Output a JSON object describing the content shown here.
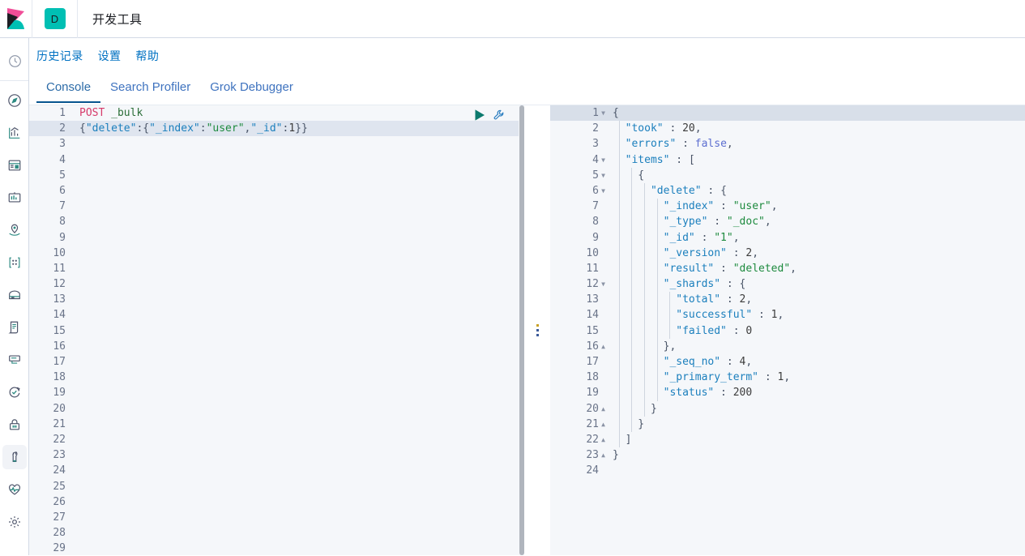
{
  "header": {
    "logo_icon": "kibana-logo",
    "app_badge": "D",
    "title": "开发工具"
  },
  "sidebar": {
    "items": [
      {
        "icon": "clock-icon",
        "name": "recently-viewed",
        "active": false
      },
      {
        "icon": "compass-icon",
        "name": "discover",
        "active": false
      },
      {
        "icon": "visualize-icon",
        "name": "visualize",
        "active": false
      },
      {
        "icon": "dashboard-icon",
        "name": "dashboard",
        "active": false
      },
      {
        "icon": "canvas-icon",
        "name": "canvas",
        "active": false
      },
      {
        "icon": "maps-icon",
        "name": "maps",
        "active": false
      },
      {
        "icon": "machine-learning-icon",
        "name": "machine-learning",
        "active": false
      },
      {
        "icon": "infrastructure-icon",
        "name": "infrastructure",
        "active": false
      },
      {
        "icon": "logs-icon",
        "name": "logs",
        "active": false
      },
      {
        "icon": "apm-icon",
        "name": "apm",
        "active": false
      },
      {
        "icon": "uptime-icon",
        "name": "uptime",
        "active": false
      },
      {
        "icon": "lock-icon",
        "name": "siem",
        "active": false
      },
      {
        "icon": "wrench-icon",
        "name": "dev-tools",
        "active": true
      },
      {
        "icon": "heartbeat-icon",
        "name": "monitoring",
        "active": false
      },
      {
        "icon": "gear-icon",
        "name": "management",
        "active": false
      }
    ]
  },
  "console": {
    "menu": [
      {
        "label": "历史记录",
        "name": "history-link"
      },
      {
        "label": "设置",
        "name": "settings-link"
      },
      {
        "label": "帮助",
        "name": "help-link"
      }
    ],
    "tabs": [
      {
        "label": "Console",
        "name": "tab-console",
        "active": true
      },
      {
        "label": "Search Profiler",
        "name": "tab-search-profiler",
        "active": false
      },
      {
        "label": "Grok Debugger",
        "name": "tab-grok-debugger",
        "active": false
      }
    ]
  },
  "request_editor": {
    "active_line": 2,
    "total_lines": 29,
    "play_icon": "play-icon",
    "wrench_icon": "wrench-icon",
    "lines": [
      {
        "n": 1,
        "tokens": [
          {
            "t": "POST ",
            "c": "tk-method"
          },
          {
            "t": "_bulk",
            "c": "tk-url"
          }
        ]
      },
      {
        "n": 2,
        "tokens": [
          {
            "t": "{",
            "c": "tk-punct"
          },
          {
            "t": "\"delete\"",
            "c": "tk-key"
          },
          {
            "t": ":{",
            "c": "tk-punct"
          },
          {
            "t": "\"_index\"",
            "c": "tk-key"
          },
          {
            "t": ":",
            "c": "tk-punct"
          },
          {
            "t": "\"user\"",
            "c": "tk-str"
          },
          {
            "t": ",",
            "c": "tk-punct"
          },
          {
            "t": "\"_id\"",
            "c": "tk-key"
          },
          {
            "t": ":",
            "c": "tk-punct"
          },
          {
            "t": "1",
            "c": "tk-num"
          },
          {
            "t": "}}",
            "c": "tk-punct"
          }
        ]
      }
    ]
  },
  "response_editor": {
    "active_line": 1,
    "total_lines": 24,
    "lines": [
      {
        "n": 1,
        "fold": "down",
        "depth": 0,
        "tokens": [
          {
            "t": "{",
            "c": "tk-punct"
          }
        ]
      },
      {
        "n": 2,
        "fold": "",
        "depth": 1,
        "tokens": [
          {
            "t": "  \"took\"",
            "c": "tk-key"
          },
          {
            "t": " : ",
            "c": "tk-punct"
          },
          {
            "t": "20",
            "c": "tk-num"
          },
          {
            "t": ",",
            "c": "tk-punct"
          }
        ]
      },
      {
        "n": 3,
        "fold": "",
        "depth": 1,
        "tokens": [
          {
            "t": "  \"errors\"",
            "c": "tk-key"
          },
          {
            "t": " : ",
            "c": "tk-punct"
          },
          {
            "t": "false",
            "c": "tk-bool"
          },
          {
            "t": ",",
            "c": "tk-punct"
          }
        ]
      },
      {
        "n": 4,
        "fold": "down",
        "depth": 1,
        "tokens": [
          {
            "t": "  \"items\"",
            "c": "tk-key"
          },
          {
            "t": " : ",
            "c": "tk-punct"
          },
          {
            "t": "[",
            "c": "tk-punct"
          }
        ]
      },
      {
        "n": 5,
        "fold": "down",
        "depth": 2,
        "tokens": [
          {
            "t": "    {",
            "c": "tk-punct"
          }
        ]
      },
      {
        "n": 6,
        "fold": "down",
        "depth": 3,
        "tokens": [
          {
            "t": "      \"delete\"",
            "c": "tk-key"
          },
          {
            "t": " : ",
            "c": "tk-punct"
          },
          {
            "t": "{",
            "c": "tk-punct"
          }
        ]
      },
      {
        "n": 7,
        "fold": "",
        "depth": 4,
        "tokens": [
          {
            "t": "        \"_index\"",
            "c": "tk-key"
          },
          {
            "t": " : ",
            "c": "tk-punct"
          },
          {
            "t": "\"user\"",
            "c": "tk-str"
          },
          {
            "t": ",",
            "c": "tk-punct"
          }
        ]
      },
      {
        "n": 8,
        "fold": "",
        "depth": 4,
        "tokens": [
          {
            "t": "        \"_type\"",
            "c": "tk-key"
          },
          {
            "t": " : ",
            "c": "tk-punct"
          },
          {
            "t": "\"_doc\"",
            "c": "tk-str"
          },
          {
            "t": ",",
            "c": "tk-punct"
          }
        ]
      },
      {
        "n": 9,
        "fold": "",
        "depth": 4,
        "tokens": [
          {
            "t": "        \"_id\"",
            "c": "tk-key"
          },
          {
            "t": " : ",
            "c": "tk-punct"
          },
          {
            "t": "\"1\"",
            "c": "tk-str"
          },
          {
            "t": ",",
            "c": "tk-punct"
          }
        ]
      },
      {
        "n": 10,
        "fold": "",
        "depth": 4,
        "tokens": [
          {
            "t": "        \"_version\"",
            "c": "tk-key"
          },
          {
            "t": " : ",
            "c": "tk-punct"
          },
          {
            "t": "2",
            "c": "tk-num"
          },
          {
            "t": ",",
            "c": "tk-punct"
          }
        ]
      },
      {
        "n": 11,
        "fold": "",
        "depth": 4,
        "tokens": [
          {
            "t": "        \"result\"",
            "c": "tk-key"
          },
          {
            "t": " : ",
            "c": "tk-punct"
          },
          {
            "t": "\"deleted\"",
            "c": "tk-str"
          },
          {
            "t": ",",
            "c": "tk-punct"
          }
        ]
      },
      {
        "n": 12,
        "fold": "down",
        "depth": 4,
        "tokens": [
          {
            "t": "        \"_shards\"",
            "c": "tk-key"
          },
          {
            "t": " : ",
            "c": "tk-punct"
          },
          {
            "t": "{",
            "c": "tk-punct"
          }
        ]
      },
      {
        "n": 13,
        "fold": "",
        "depth": 5,
        "tokens": [
          {
            "t": "          \"total\"",
            "c": "tk-key"
          },
          {
            "t": " : ",
            "c": "tk-punct"
          },
          {
            "t": "2",
            "c": "tk-num"
          },
          {
            "t": ",",
            "c": "tk-punct"
          }
        ]
      },
      {
        "n": 14,
        "fold": "",
        "depth": 5,
        "tokens": [
          {
            "t": "          \"successful\"",
            "c": "tk-key"
          },
          {
            "t": " : ",
            "c": "tk-punct"
          },
          {
            "t": "1",
            "c": "tk-num"
          },
          {
            "t": ",",
            "c": "tk-punct"
          }
        ]
      },
      {
        "n": 15,
        "fold": "",
        "depth": 5,
        "tokens": [
          {
            "t": "          \"failed\"",
            "c": "tk-key"
          },
          {
            "t": " : ",
            "c": "tk-punct"
          },
          {
            "t": "0",
            "c": "tk-num"
          }
        ]
      },
      {
        "n": 16,
        "fold": "up",
        "depth": 4,
        "tokens": [
          {
            "t": "        },",
            "c": "tk-punct"
          }
        ]
      },
      {
        "n": 17,
        "fold": "",
        "depth": 4,
        "tokens": [
          {
            "t": "        \"_seq_no\"",
            "c": "tk-key"
          },
          {
            "t": " : ",
            "c": "tk-punct"
          },
          {
            "t": "4",
            "c": "tk-num"
          },
          {
            "t": ",",
            "c": "tk-punct"
          }
        ]
      },
      {
        "n": 18,
        "fold": "",
        "depth": 4,
        "tokens": [
          {
            "t": "        \"_primary_term\"",
            "c": "tk-key"
          },
          {
            "t": " : ",
            "c": "tk-punct"
          },
          {
            "t": "1",
            "c": "tk-num"
          },
          {
            "t": ",",
            "c": "tk-punct"
          }
        ]
      },
      {
        "n": 19,
        "fold": "",
        "depth": 4,
        "tokens": [
          {
            "t": "        \"status\"",
            "c": "tk-key"
          },
          {
            "t": " : ",
            "c": "tk-punct"
          },
          {
            "t": "200",
            "c": "tk-num"
          }
        ]
      },
      {
        "n": 20,
        "fold": "up",
        "depth": 3,
        "tokens": [
          {
            "t": "      }",
            "c": "tk-punct"
          }
        ]
      },
      {
        "n": 21,
        "fold": "up",
        "depth": 2,
        "tokens": [
          {
            "t": "    }",
            "c": "tk-punct"
          }
        ]
      },
      {
        "n": 22,
        "fold": "up",
        "depth": 1,
        "tokens": [
          {
            "t": "  ]",
            "c": "tk-punct"
          }
        ]
      },
      {
        "n": 23,
        "fold": "up",
        "depth": 0,
        "tokens": [
          {
            "t": "}",
            "c": "tk-punct"
          }
        ]
      },
      {
        "n": 24,
        "fold": "",
        "depth": 0,
        "tokens": []
      }
    ]
  },
  "colors": {
    "brand_teal": "#00bfb3",
    "brand_pink": "#f04e98",
    "link_blue": "#0071c2",
    "tab_active_underline": "#07558f",
    "editor_bg": "#f5f7fa",
    "active_line": "#dfe5ef"
  }
}
